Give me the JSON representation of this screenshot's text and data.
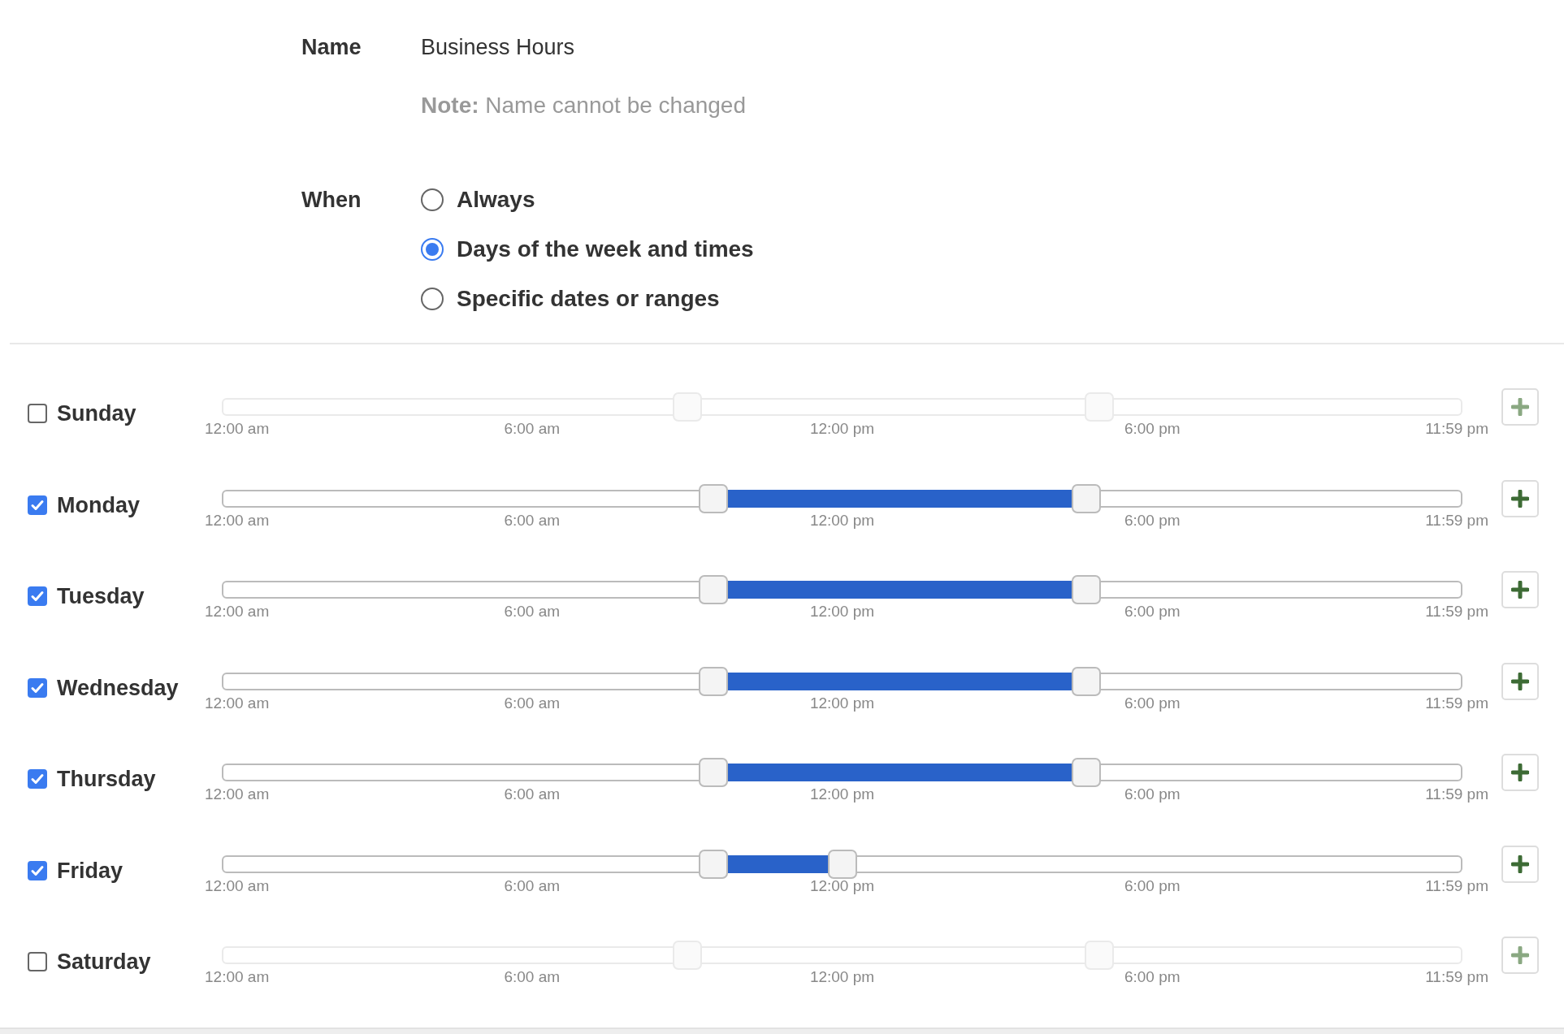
{
  "name_field": {
    "label": "Name",
    "value": "Business Hours",
    "note": "**Note:** Name cannot be changed"
  },
  "when": {
    "label": "When",
    "options": [
      {
        "label": "Always",
        "selected": false
      },
      {
        "label": "Days of the week and times",
        "selected": true
      },
      {
        "label": "Specific dates or ranges",
        "selected": false
      }
    ]
  },
  "days": [
    {
      "name": "Sunday",
      "checked": false,
      "thumbs": [
        {
          "level": 0.375
        },
        {
          "level": 0.707
        }
      ],
      "ticks": [
        "12:00 am",
        "6:00 am",
        "12:00 pm",
        "6:00 pm",
        "11:59 pm"
      ]
    },
    {
      "name": "Monday",
      "checked": true,
      "thumbs": [
        {
          "level": 0.396
        },
        {
          "level": 0.697
        }
      ],
      "ticks": [
        "12:00 am",
        "6:00 am",
        "12:00 pm",
        "6:00 pm",
        "11:59 pm"
      ]
    },
    {
      "name": "Tuesday",
      "checked": true,
      "thumbs": [
        {
          "level": 0.396
        },
        {
          "level": 0.697
        }
      ],
      "ticks": [
        "12:00 am",
        "6:00 am",
        "12:00 pm",
        "6:00 pm",
        "11:59 pm"
      ]
    },
    {
      "name": "Wednesday",
      "checked": true,
      "thumbs": [
        {
          "level": 0.396
        },
        {
          "level": 0.697
        }
      ],
      "ticks": [
        "12:00 am",
        "6:00 am",
        "12:00 pm",
        "6:00 pm",
        "11:59 pm"
      ]
    },
    {
      "name": "Thursday",
      "checked": true,
      "thumbs": [
        {
          "level": 0.396
        },
        {
          "level": 0.697
        }
      ],
      "ticks": [
        "12:00 am",
        "6:00 am",
        "12:00 pm",
        "6:00 pm",
        "11:59 pm"
      ]
    },
    {
      "name": "Friday",
      "checked": true,
      "thumbs": [
        {
          "level": 0.396
        },
        {
          "level": 0.5
        }
      ],
      "ticks": [
        "12:00 am",
        "6:00 am",
        "12:00 pm",
        "6:00 pm",
        "11:59 pm"
      ]
    },
    {
      "name": "Saturday",
      "checked": false,
      "thumbs": [
        {
          "level": 0.375
        },
        {
          "level": 0.707
        }
      ],
      "ticks": [
        "12:00 am",
        "6:00 am",
        "12:00 pm",
        "6:00 pm",
        "11:59 pm"
      ]
    }
  ]
}
